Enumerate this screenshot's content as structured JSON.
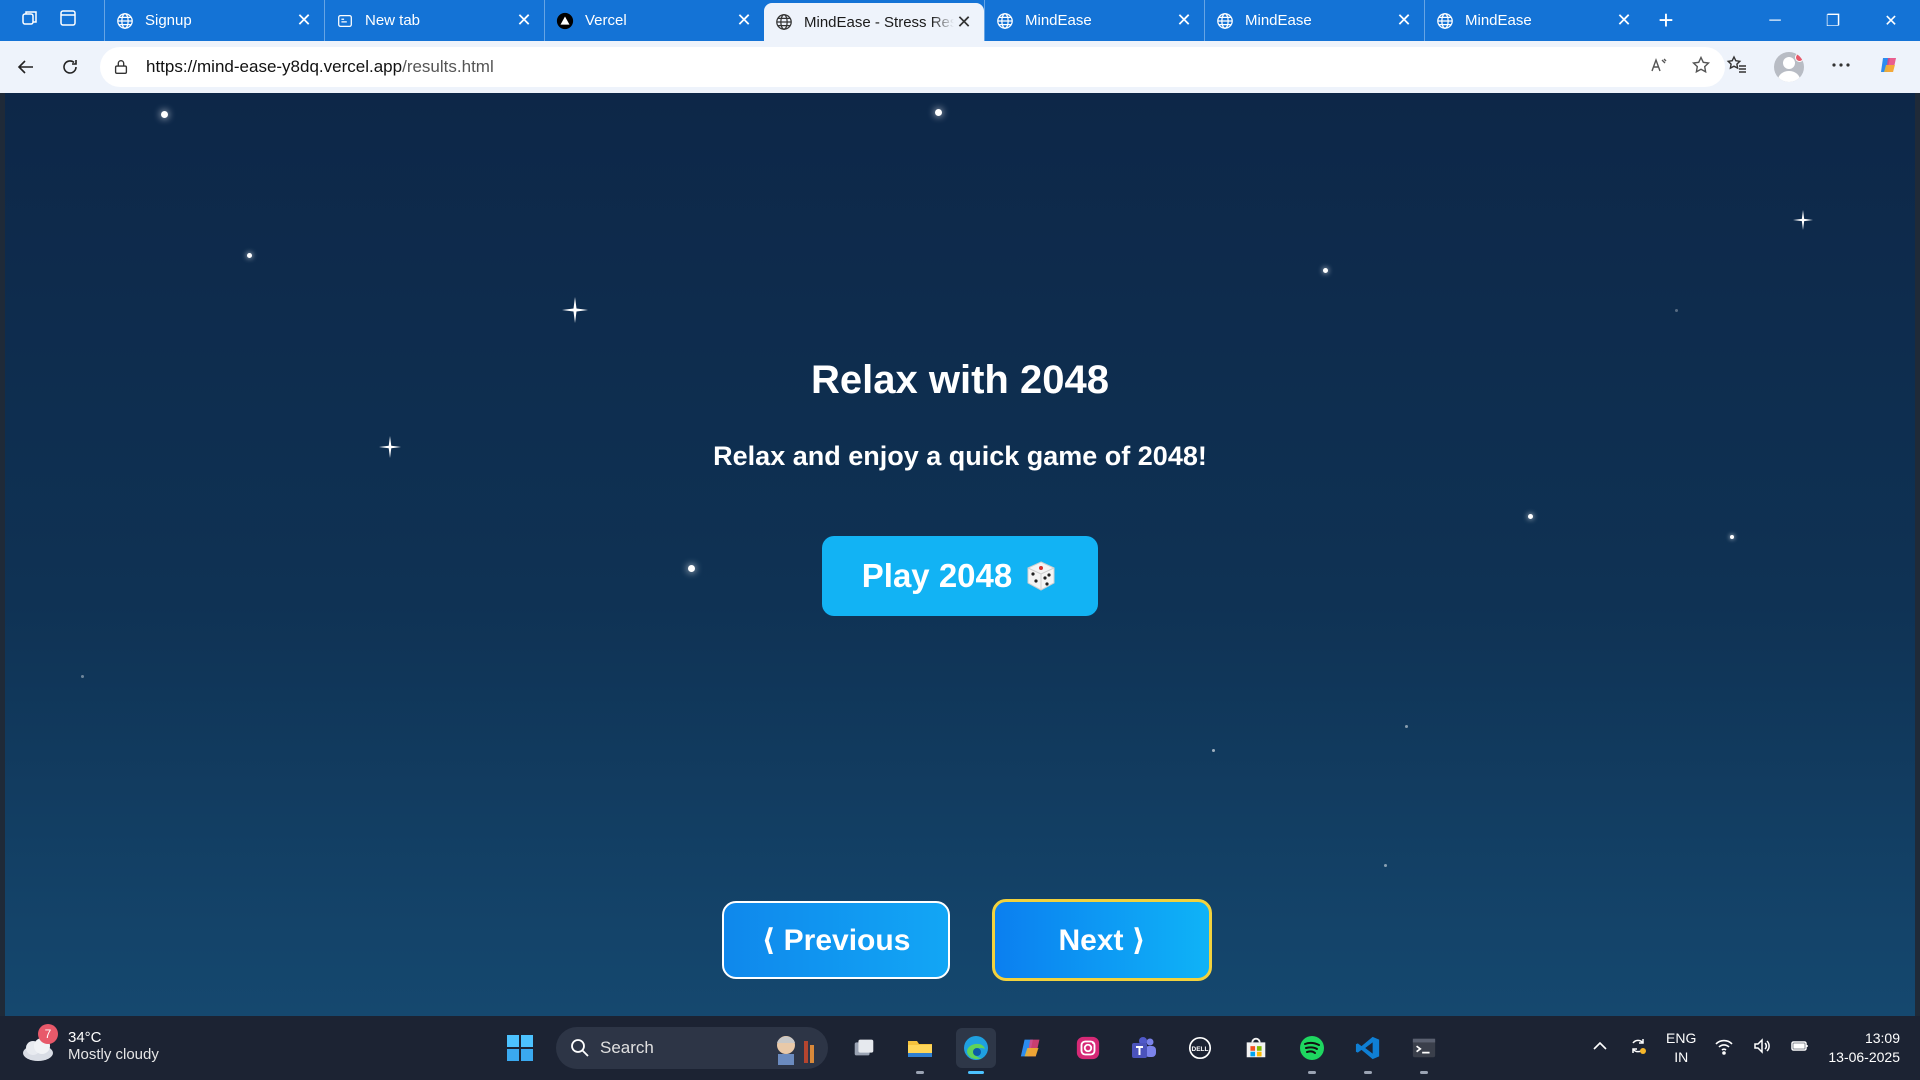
{
  "browser": {
    "tabs": [
      {
        "title": "Signup",
        "favicon": "globe-icon",
        "active": false
      },
      {
        "title": "New tab",
        "favicon": "newtab-icon",
        "active": false
      },
      {
        "title": "Vercel",
        "favicon": "vercel-icon",
        "active": false
      },
      {
        "title": "MindEase - Stress Res",
        "favicon": "globe-icon",
        "active": true
      },
      {
        "title": "MindEase",
        "favicon": "globe-icon",
        "active": false
      },
      {
        "title": "MindEase",
        "favicon": "globe-icon",
        "active": false
      },
      {
        "title": "MindEase",
        "favicon": "globe-icon",
        "active": false
      }
    ],
    "url_host": "https://mind-ease-y8dq.vercel.app",
    "url_path": "/results.html"
  },
  "page": {
    "heading": "Relax with 2048",
    "subtitle": "Relax and enjoy a quick game of 2048!",
    "play_label": "Play 2048",
    "play_icon": "dice-icon",
    "previous_label": "⟨ Previous",
    "next_label": "Next ⟩"
  },
  "taskbar": {
    "weather_badge": "7",
    "temperature": "34°C",
    "condition": "Mostly cloudy",
    "search_placeholder": "Search",
    "lang_top": "ENG",
    "lang_bottom": "IN",
    "time": "13:09",
    "date": "13-06-2025"
  },
  "colors": {
    "tab_strip": "#1473d6",
    "page_bg_top": "#0d2748",
    "page_bg_bottom": "#15486f",
    "play_button": "#12b3f4",
    "next_border": "#f2d23d"
  }
}
